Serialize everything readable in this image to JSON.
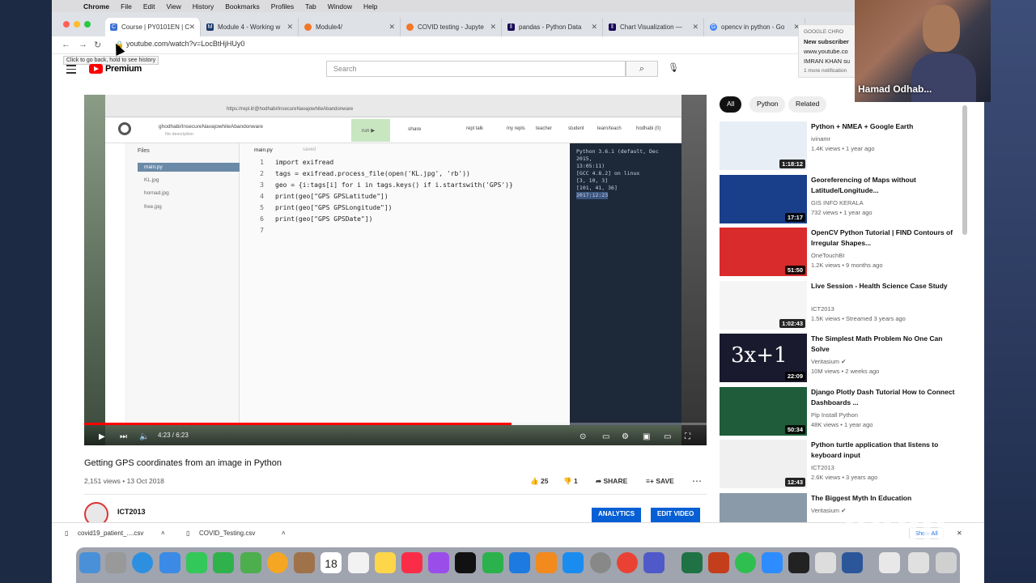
{
  "menubar": {
    "app": "Chrome",
    "items": [
      "File",
      "Edit",
      "View",
      "History",
      "Bookmarks",
      "Profiles",
      "Tab",
      "Window",
      "Help"
    ]
  },
  "tabs": [
    {
      "label": "Course | PY0101EN | C",
      "color": "#3b6fd6"
    },
    {
      "label": "Module 4 - Working w",
      "color": "#1a3a6b"
    },
    {
      "label": "Module4/",
      "color": "#f37726"
    },
    {
      "label": "COVID testing - Jupyte",
      "color": "#f37726"
    },
    {
      "label": "pandas - Python Data",
      "color": "#150458"
    },
    {
      "label": "Chart Visualization —",
      "color": "#150458"
    },
    {
      "label": "opencv in python - Go",
      "color": "#4285f4"
    }
  ],
  "address": {
    "url": "youtube.com/watch?v=LocBtHjHUy0",
    "tooltip": "Click to go back, hold to see history"
  },
  "youtube": {
    "logo": "Premium",
    "search_placeholder": "Search"
  },
  "video": {
    "repl_url": "https://repl.it/@hodhabi/InsecureNavajowhiteAbandonware",
    "repl_project": "ghodhabi/InsecureNavajowhiteAbandonware",
    "repl_desc": "No description",
    "run": "run ▶",
    "share": "share",
    "nav": [
      "repl talk",
      "my repls",
      "teacher",
      "student",
      "learn/teach",
      "hodhabi (0)"
    ],
    "files_label": "Files",
    "files": [
      "main.py",
      "KL.jpg",
      "hornad.jpg",
      "free.jpg"
    ],
    "editor_tab": "main.py",
    "saved": "saved",
    "code": [
      "import exifread",
      "tags = exifread.process_file(open('KL.jpg', 'rb'))",
      "geo = {i:tags[i] for i in tags.keys() if i.startswith('GPS')}",
      "print(geo[\"GPS GPSLatitude\"])",
      "print(geo[\"GPS GPSLongitude\"])",
      "print(geo[\"GPS GPSDate\"])",
      ""
    ],
    "console": [
      "Python 3.6.1 (default, Dec 2015,",
      "13:05:11)",
      "[GCC 4.8.2] on linux",
      "",
      "[3, 10, 3]",
      "[101, 41, 36]",
      "2017:12:23"
    ],
    "timecode": "4:23 / 6:23",
    "progress": 0.686,
    "title": "Getting GPS coordinates from an image in Python",
    "meta": "2,151 views • 13 Oct 2018",
    "likes": "25",
    "dislikes": "1",
    "share_label": "SHARE",
    "save_label": "SAVE",
    "channel": "ICT2013",
    "analytics": "ANALYTICS",
    "edit_video": "EDIT VIDEO"
  },
  "chips": [
    "All",
    "Python",
    "Related"
  ],
  "recommendations": [
    {
      "title": "Python + NMEA + Google Earth",
      "channel": "ivinamr",
      "views": "1.4K views • 1 year ago",
      "duration": "1:18:12",
      "color": "#e8eef5"
    },
    {
      "title": "Georeferencing of Maps without Latitude/Longitude...",
      "channel": "GIS INFO KERALA",
      "views": "732 views • 1 year ago",
      "duration": "17:17",
      "color": "#1a3f8a"
    },
    {
      "title": "OpenCV Python Tutorial | FIND Contours of Irregular Shapes...",
      "channel": "OneTouchBI",
      "views": "1.2K views • 9 months ago",
      "duration": "51:50",
      "color": "#d92b2b"
    },
    {
      "title": "Live Session - Health Science Case Study",
      "channel": "ICT2013",
      "views": "1.5K views • Streamed 3 years ago",
      "duration": "1:02:43",
      "color": "#f5f5f5"
    },
    {
      "title": "The Simplest Math Problem No One Can Solve",
      "channel": "Veritasium",
      "views": "10M views • 2 weeks ago",
      "duration": "22:09",
      "color": "#1a1a2e"
    },
    {
      "title": "Django Plotly Dash Tutorial How to Connect Dashboards ...",
      "channel": "Pip Install Python",
      "views": "48K views • 1 year ago",
      "duration": "50:34",
      "color": "#1f5d3a"
    },
    {
      "title": "Python turtle application that listens to keyboard input",
      "channel": "ICT2013",
      "views": "2.6K views • 3 years ago",
      "duration": "12:43",
      "color": "#f0f0f0"
    },
    {
      "title": "The Biggest Myth In Education",
      "channel": "Veritasium",
      "views": "",
      "duration": "",
      "color": "#8a9aa8"
    }
  ],
  "downloads": [
    {
      "name": "covid19_patient_....csv"
    },
    {
      "name": "COVID_Testing.csv"
    }
  ],
  "show_all": "Show All",
  "notification": {
    "source": "GOOGLE CHRO",
    "title": "New subscriber",
    "line1": "www.youtube.co",
    "line2": "IMRAN KHAN su",
    "more": "1 more notification"
  },
  "webcam_name": "Hamad Odhab...",
  "dock_date": "18",
  "zoom_watermark": "zoom"
}
